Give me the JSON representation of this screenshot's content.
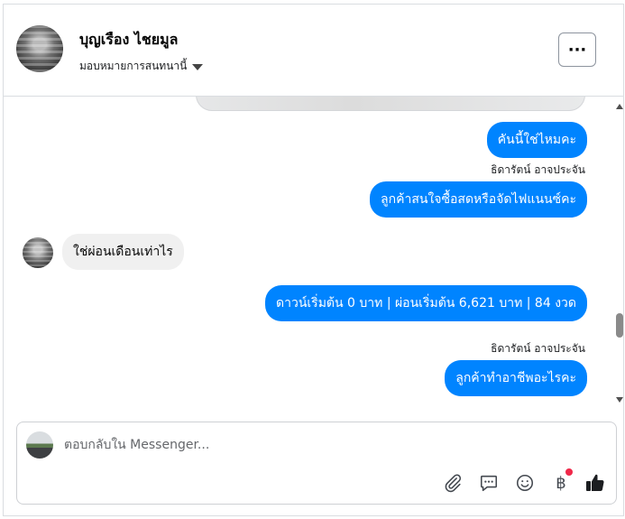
{
  "header": {
    "contact_name": "บุญเรือง ไชยมูล",
    "assign_label": "มอบหมายการสนทนานี้",
    "more_label": "···"
  },
  "messages": [
    {
      "direction": "out",
      "text": "คันนี้ใช่ไหมคะ"
    },
    {
      "direction": "out",
      "sender": "ธิดารัตน์ อาจประจัน",
      "text": "ลูกค้าสนใจซื้อสดหรือจัดไฟแนนซ์คะ"
    },
    {
      "direction": "in",
      "text": "ใช่ผ่อนเดือนเท่าไร"
    },
    {
      "direction": "out",
      "text": "ดาวน์เริ่มต้น 0 บาท | ผ่อนเริ่มต้น 6,621 บาท | 84 งวด"
    },
    {
      "direction": "out",
      "sender": "ธิดารัตน์ อาจประจัน",
      "text": "ลูกค้าทำอาชีพอะไรคะ"
    }
  ],
  "composer": {
    "placeholder": "ตอบกลับใน Messenger...",
    "tools": [
      "paperclip-icon",
      "saved-reply-icon",
      "emoji-icon",
      "payment-icon",
      "like-icon"
    ],
    "payment_symbol": "฿"
  },
  "colors": {
    "outgoing_bubble": "#0084ff",
    "incoming_bubble": "#f0f0f0",
    "notification_dot": "#f02849"
  }
}
